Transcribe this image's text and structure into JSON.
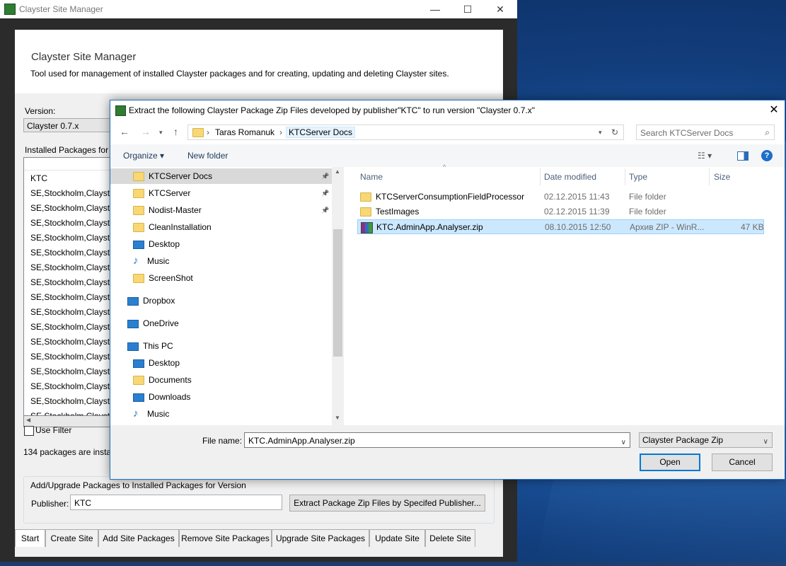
{
  "main_window": {
    "title": "Clayster Site Manager",
    "controls": {
      "minimize": "—",
      "maximize": "☐",
      "close": "✕"
    },
    "header": {
      "title": "Clayster Site Manager",
      "description": "Tool used for management of installed Clayster packages and for creating, updating and deleting Clayster sites."
    },
    "version_label": "Version:",
    "version_value": "Clayster 0.7.x",
    "installed_label": "Installed Packages for V",
    "packages": [
      "KTC",
      "SE,Stockholm,Clayste",
      "SE,Stockholm,Clayste",
      "SE,Stockholm,Clayste",
      "SE,Stockholm,Clayste",
      "SE,Stockholm,Clayste",
      "SE,Stockholm,Clayste",
      "SE,Stockholm,Clayste",
      "SE,Stockholm,Clayste",
      "SE,Stockholm,Clayste",
      "SE,Stockholm,Clayste",
      "SE,Stockholm,Clayste",
      "SE,Stockholm,Clayste",
      "SE,Stockholm,Clayste",
      "SE,Stockholm,Clayste",
      "SE,Stockholm,Clayste",
      "SE,Stockholm,Clayste"
    ],
    "use_filter_label": "Use Filter",
    "count_text": "134 packages are instal",
    "group_title": "Add/Upgrade Packages to Installed Packages for Version",
    "publisher_label": "Publisher:",
    "publisher_value": "KTC",
    "extract_button": "Extract Package Zip Files by Specifed Publisher...",
    "tabs": [
      "Start",
      "Create Site",
      "Add Site Packages",
      "Remove Site Packages",
      "Upgrade Site Packages",
      "Update Site",
      "Delete Site"
    ]
  },
  "dialog": {
    "title": "Extract the following Clayster Package Zip Files developed by publisher\"KTC\" to run version \"Clayster 0.7.x\"",
    "breadcrumb": [
      "Taras Romanuk",
      "KTCServer Docs"
    ],
    "search_placeholder": "Search KTCServer Docs",
    "organize_label": "Organize ▾",
    "new_folder_label": "New folder",
    "nav_items": [
      {
        "label": "KTCServer Docs",
        "icon": "folder-icon",
        "pinned": true
      },
      {
        "label": "KTCServer",
        "icon": "folder-icon",
        "pinned": true
      },
      {
        "label": "Nodist-Master",
        "icon": "folder-icon",
        "pinned": true
      },
      {
        "label": "CleanInstallation",
        "icon": "folder-icon",
        "pinned": false
      },
      {
        "label": "Desktop",
        "icon": "desktop-icon",
        "pinned": false
      },
      {
        "label": "Music",
        "icon": "music-icon",
        "pinned": false
      },
      {
        "label": "ScreenShot",
        "icon": "folder-icon",
        "pinned": false
      },
      {
        "label": "Dropbox",
        "icon": "dropbox-icon",
        "pinned": false
      },
      {
        "label": "OneDrive",
        "icon": "onedrive-icon",
        "pinned": false
      },
      {
        "label": "This PC",
        "icon": "computer-icon",
        "pinned": false
      },
      {
        "label": "Desktop",
        "icon": "desktop-icon",
        "pinned": false
      },
      {
        "label": "Documents",
        "icon": "documents-icon",
        "pinned": false
      },
      {
        "label": "Downloads",
        "icon": "downloads-icon",
        "pinned": false
      },
      {
        "label": "Music",
        "icon": "music-icon",
        "pinned": false
      }
    ],
    "columns": {
      "name": "Name",
      "date": "Date modified",
      "type": "Type",
      "size": "Size"
    },
    "files": [
      {
        "name": "KTCServerConsumptionFieldProcessor",
        "date": "02.12.2015 11:43",
        "type": "File folder",
        "size": "",
        "icon": "folder-icon"
      },
      {
        "name": "TestImages",
        "date": "02.12.2015 11:39",
        "type": "File folder",
        "size": "",
        "icon": "folder-icon"
      },
      {
        "name": "KTC.AdminApp.Analyser.zip",
        "date": "08.10.2015 12:50",
        "type": "Архив ZIP - WinR...",
        "size": "47 KB",
        "icon": "winrar-zip-icon"
      }
    ],
    "filename_label": "File name:",
    "filename_value": "KTC.AdminApp.Analyser.zip",
    "filter_value": "Clayster Package Zip",
    "open_label": "Open",
    "cancel_label": "Cancel"
  }
}
